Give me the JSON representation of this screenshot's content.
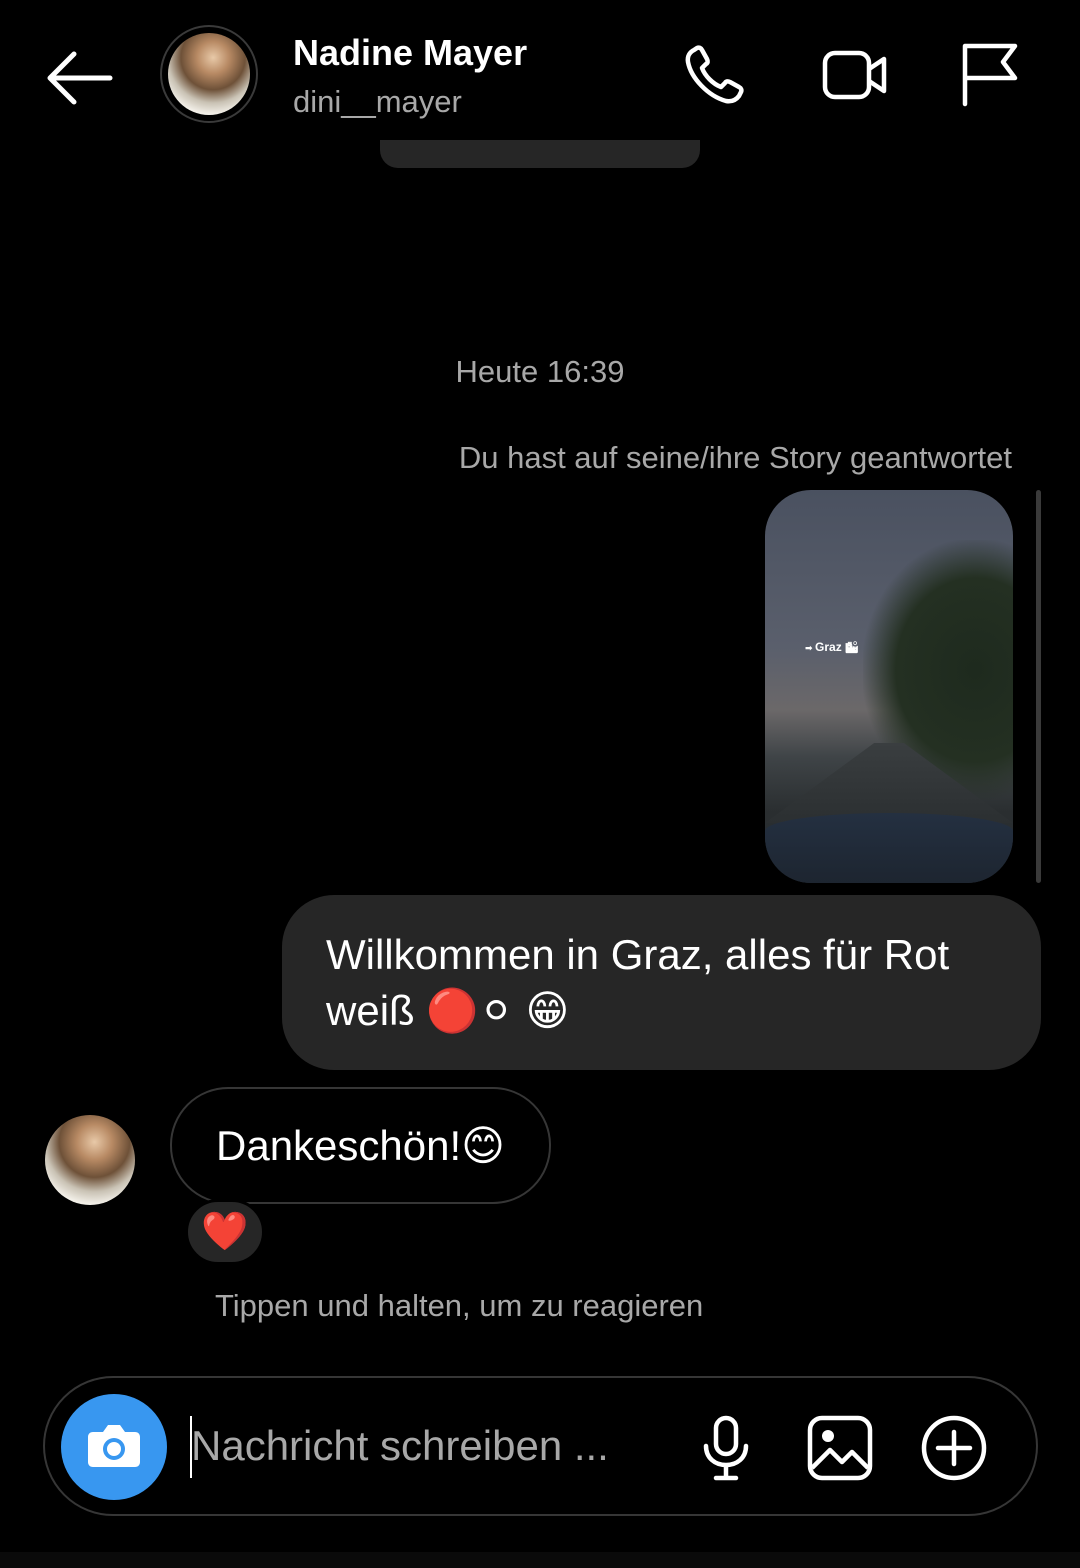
{
  "header": {
    "name": "Nadine Mayer",
    "username": "dini__mayer",
    "icons": [
      "back-arrow-icon",
      "phone-icon",
      "video-call-icon",
      "flag-icon"
    ]
  },
  "thread": {
    "timestamp": "Heute 16:39",
    "story_reply_note": "Du hast auf seine/ihre Story geantwortet",
    "story_sticker": "Graz",
    "outgoing_message": "Willkommen in Graz, alles für Rot weiß 🔴⚪ 😁",
    "incoming_message": "Dankeschön!😊",
    "reaction": "❤️",
    "reaction_hint": "Tippen und halten, um zu reagieren"
  },
  "composer": {
    "placeholder": "Nachricht schreiben ...",
    "icons": [
      "camera-icon",
      "microphone-icon",
      "gallery-icon",
      "add-circle-icon"
    ]
  },
  "colors": {
    "background": "#000000",
    "bubble": "#262626",
    "secondary_text": "#a8a8a8",
    "camera_button": "#3897f0"
  }
}
